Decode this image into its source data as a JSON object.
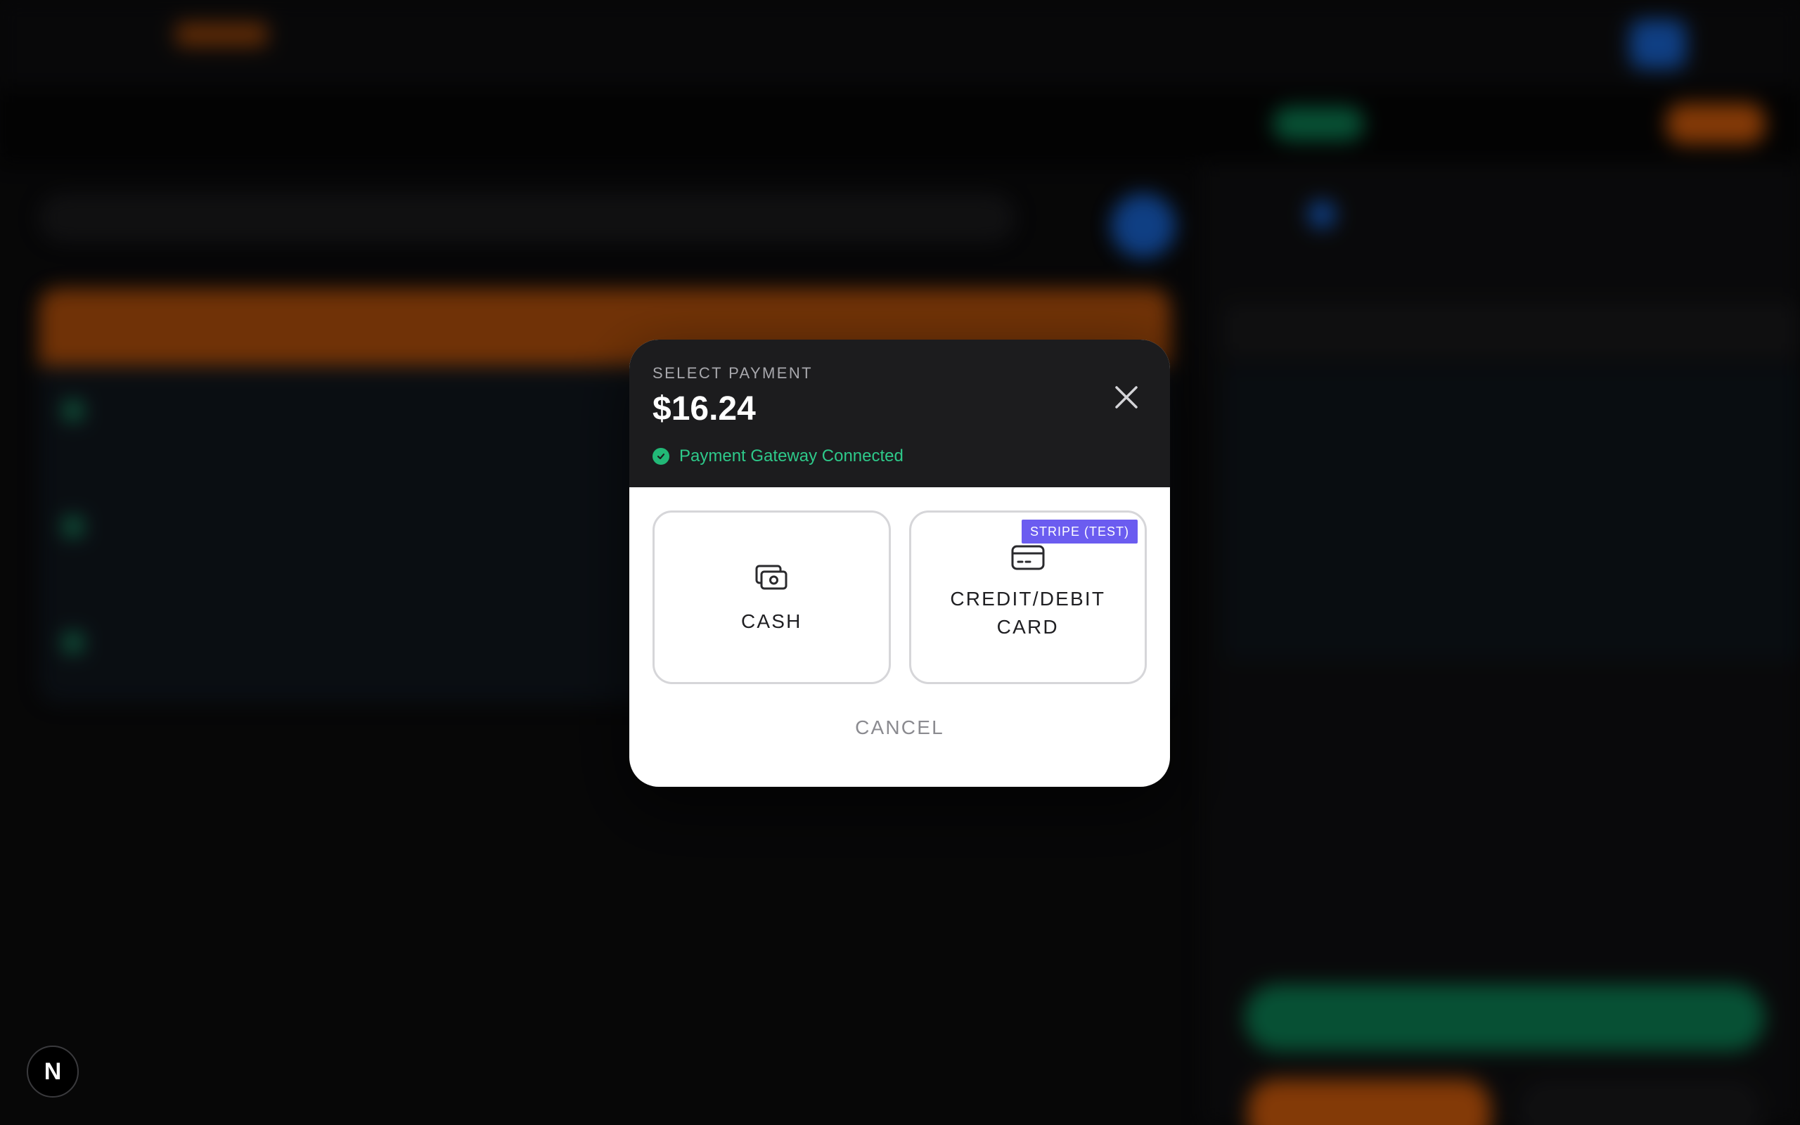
{
  "modal": {
    "title": "SELECT PAYMENT",
    "amount": "$16.24",
    "status": "Payment Gateway Connected",
    "options": [
      {
        "id": "cash",
        "label": "CASH",
        "icon": "cash-icon"
      },
      {
        "id": "card",
        "label": "CREDIT/DEBIT CARD",
        "icon": "credit-card-icon",
        "badge": "STRIPE (TEST)"
      }
    ],
    "cancel_label": "CANCEL"
  },
  "dev_badge": {
    "label": "N"
  },
  "colors": {
    "status_green": "#2ec98a",
    "badge_purple": "#6b5cf0",
    "header_bg": "#1c1c1e",
    "accent_orange": "#e0620c",
    "accent_green": "#0d8a5a",
    "accent_blue": "#1a6be0"
  }
}
